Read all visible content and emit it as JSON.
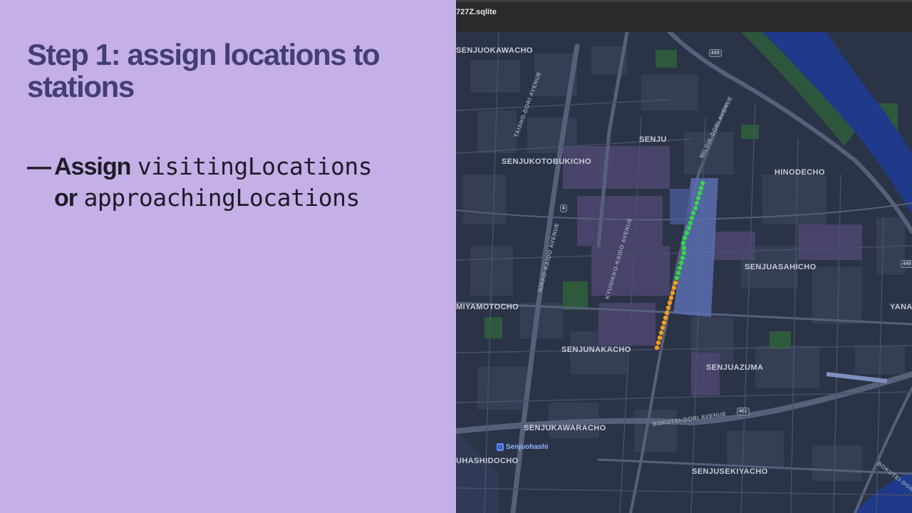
{
  "slide": {
    "title": "Step 1: assign locations to stations",
    "bullet": {
      "dash": "—",
      "line1_word": "Assign",
      "line1_code": "visitingLocations",
      "line2_word": "or",
      "line2_code": "approachingLocations"
    }
  },
  "map_window": {
    "title": "727Z.sqlite",
    "neighborhoods": [
      "SENJUOKAWACHO",
      "SENJU",
      "SENJUKOTOBUKICHO",
      "HINODECHO",
      "SENJUASAHICHO",
      "MIYAMOTOCHO",
      "YANAC",
      "SENJUNAKACHO",
      "SENJUAZUMA",
      "SENJUKAWARACHO",
      "UHASHIDOCHO",
      "SENJUSEKIYACHO"
    ],
    "roads": [
      "TAISHO-DORI AVENUE",
      "MILDIK-DORI AVENUE",
      "NIKKO-KAIDO AVENUE",
      "KYUNIKKO-KAIDO AVENUE",
      "BOKUTEI-DORI AVENUE",
      "BOKUTEI-DORI"
    ],
    "route_shields": [
      "449",
      "4",
      "449",
      "461"
    ],
    "station": {
      "name": "Senjuohashi"
    },
    "colors": {
      "visiting": "#34d64a",
      "approaching": "#f59d1a",
      "station_area": "#5b6fb0",
      "water": "#1f3a8a",
      "park": "#2e5a3c",
      "map_bg": "#2b3346"
    }
  }
}
